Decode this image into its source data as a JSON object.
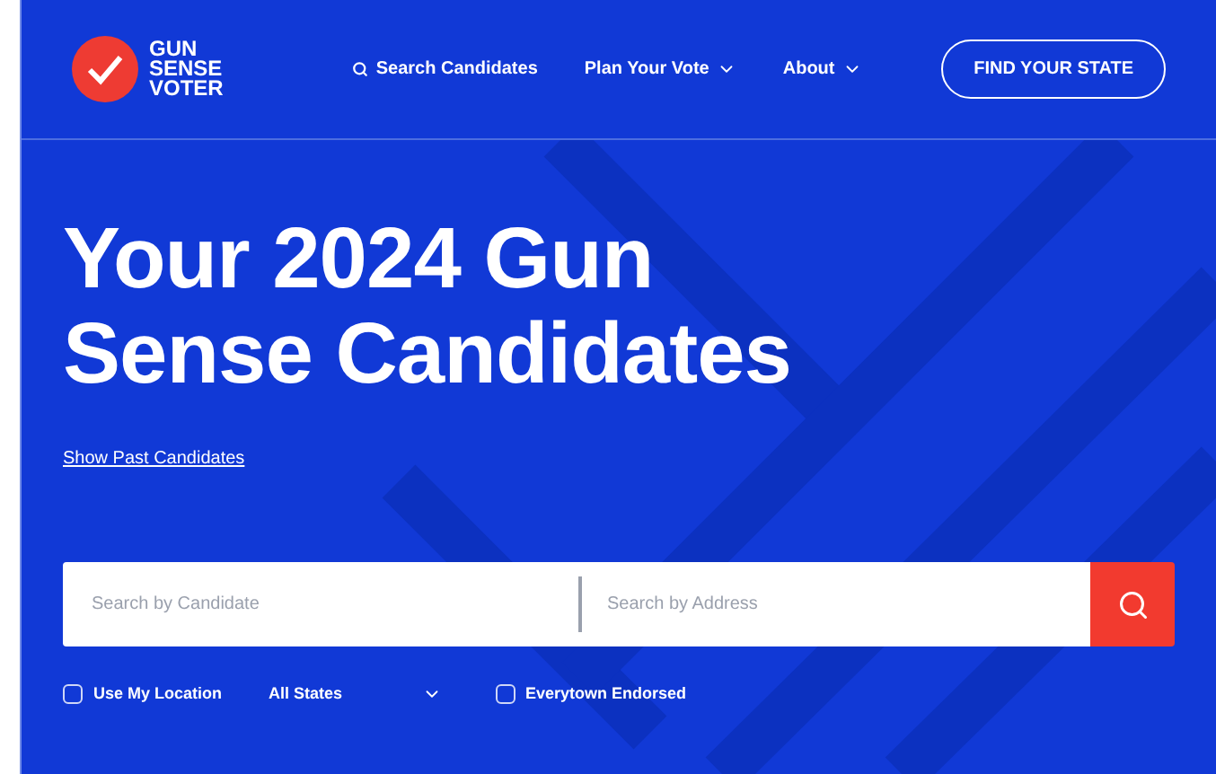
{
  "header": {
    "logo_lines": [
      "GUN",
      "SENSE",
      "VOTER"
    ],
    "nav": [
      {
        "label": "Search Candidates",
        "kind": "search"
      },
      {
        "label": "Plan Your Vote",
        "kind": "dropdown"
      },
      {
        "label": "About",
        "kind": "dropdown"
      }
    ],
    "cta": "FIND YOUR STATE"
  },
  "hero": {
    "title_lines": [
      "Your 2024 Gun",
      "Sense Candidates"
    ],
    "link": "Show Past Candidates"
  },
  "search": {
    "candidate_placeholder": "Search by Candidate",
    "address_placeholder": "Search by Address"
  },
  "options": {
    "use_location": {
      "label": "Use My Location",
      "checked": false
    },
    "state_select": "All States",
    "endorsed": {
      "label": "Everytown Endorsed",
      "checked": false
    }
  }
}
